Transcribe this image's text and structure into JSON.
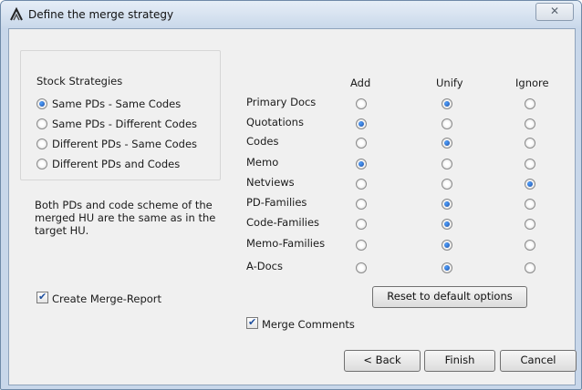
{
  "window": {
    "title": "Define the merge strategy",
    "close_label": "✕"
  },
  "stock_strategies": {
    "group_title": "Stock Strategies",
    "options": [
      {
        "label": "Same PDs - Same Codes",
        "selected": true
      },
      {
        "label": "Same PDs - Different Codes",
        "selected": false
      },
      {
        "label": "Different PDs - Same Codes",
        "selected": false
      },
      {
        "label": "Different PDs and Codes",
        "selected": false
      }
    ]
  },
  "description": "Both PDs and code scheme of the merged HU are the same as in the target HU.",
  "strategy_table": {
    "columns": [
      "Add",
      "Unify",
      "Ignore"
    ],
    "rows": [
      {
        "label": "Primary Docs",
        "selected": "Unify"
      },
      {
        "label": "Quotations",
        "selected": "Add"
      },
      {
        "label": "Codes",
        "selected": "Unify"
      },
      {
        "label": "Memo",
        "selected": "Add"
      },
      {
        "label": "Netviews",
        "selected": "Ignore"
      },
      {
        "label": "PD-Families",
        "selected": "Unify"
      },
      {
        "label": "Code-Families",
        "selected": "Unify"
      },
      {
        "label": "Memo-Families",
        "selected": "Unify"
      },
      {
        "label": "A-Docs",
        "selected": "Unify"
      }
    ]
  },
  "checkboxes": {
    "create_merge_report": {
      "label": "Create Merge-Report",
      "checked": true
    },
    "merge_comments": {
      "label": "Merge Comments",
      "checked": true
    }
  },
  "buttons": {
    "reset": "Reset to default options",
    "back": "< Back",
    "finish": "Finish",
    "cancel": "Cancel"
  }
}
